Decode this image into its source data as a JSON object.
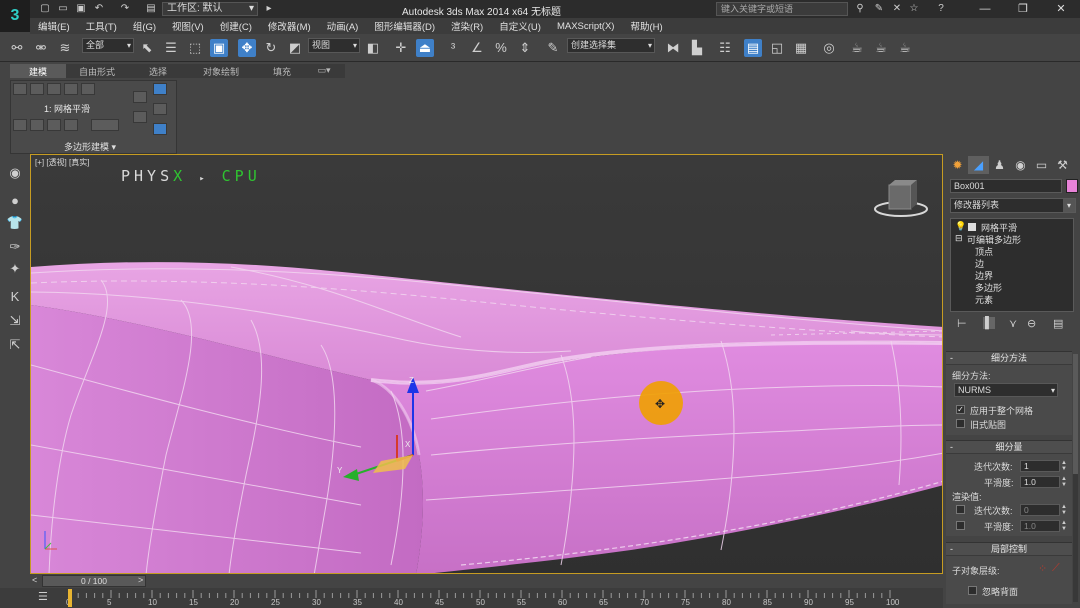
{
  "title_bar": {
    "workspace_label": "工作区: 默认",
    "app_title": "Autodesk 3ds Max  2014 x64      无标题",
    "search_placeholder": "键入关键字或短语",
    "window_buttons": [
      "—",
      "❐",
      "✕"
    ]
  },
  "menu": {
    "items": [
      "编辑(E)",
      "工具(T)",
      "组(G)",
      "视图(V)",
      "创建(C)",
      "修改器(M)",
      "动画(A)",
      "图形编辑器(D)",
      "渲染(R)",
      "自定义(U)",
      "MAXScript(X)",
      "帮助(H)"
    ]
  },
  "toolbar": {
    "selection_filter": "全部",
    "ref_coord": "视图",
    "named_selection": "创建选择集"
  },
  "ribbon": {
    "tabs": [
      "建模",
      "自由形式",
      "选择",
      "对象绘制",
      "填充"
    ],
    "modifier_label": "1: 网格平滑",
    "panel_title": "多边形建模 ▾"
  },
  "viewport": {
    "label": "[+] [透视] [真实]",
    "physx_left": "PHYS",
    "physx_x": "X",
    "physx_arrow": "▸",
    "physx_cpu": "CPU",
    "axis_x": "X",
    "axis_y": "Y",
    "axis_z": "Z",
    "object_color": "#e27bdf"
  },
  "command_panel": {
    "object_name": "Box001",
    "object_color": "#e883d8",
    "modifier_list": "修改器列表",
    "stack": {
      "top": "网格平滑",
      "base": "可编辑多边形",
      "subobjects": [
        "顶点",
        "边",
        "边界",
        "多边形",
        "元素"
      ]
    },
    "subdivision_method": {
      "header": "细分方法",
      "method_label": "细分方法:",
      "method_value": "NURMS",
      "apply_whole": "应用于整个网格",
      "apply_whole_checked": true,
      "old_style": "旧式贴图",
      "old_style_checked": false
    },
    "subdivision_amount": {
      "header": "细分量",
      "iterations_label": "迭代次数:",
      "iterations_value": "1",
      "smoothness_label": "平滑度:",
      "smoothness_value": "1.0",
      "render_values_label": "渲染值:",
      "render_iterations_value": "0",
      "render_smoothness_value": "1.0"
    },
    "local_control": {
      "header": "局部控制",
      "sub_level_label": "子对象层级:",
      "ignore_backface": "忽略背面"
    }
  },
  "timeline": {
    "slider_text": "0 / 100",
    "ticks": [
      "0",
      "5",
      "10",
      "15",
      "20",
      "25",
      "30",
      "35",
      "40",
      "45",
      "50",
      "55",
      "60",
      "65",
      "70",
      "75",
      "80",
      "85",
      "90",
      "95",
      "100"
    ]
  }
}
